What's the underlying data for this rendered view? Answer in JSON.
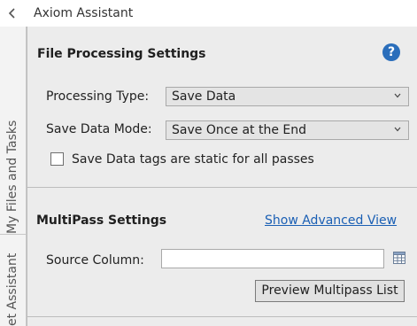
{
  "app": {
    "title": "Axiom Assistant",
    "back_icon": "chevron-left-icon"
  },
  "sidebar": {
    "tabs": [
      {
        "label": "My Files and Tasks"
      },
      {
        "label": "et Assistant"
      }
    ]
  },
  "file_processing": {
    "title": "File Processing Settings",
    "help_icon": "help-circle-icon",
    "help_glyph": "?",
    "processing_type": {
      "label": "Processing Type:",
      "value": "Save Data"
    },
    "save_data_mode": {
      "label": "Save Data Mode:",
      "value": "Save Once at the End"
    },
    "static_tags": {
      "label": "Save Data tags are static for all passes",
      "checked": false
    }
  },
  "multipass": {
    "title": "MultiPass Settings",
    "advanced_link": "Show Advanced View",
    "source_column": {
      "label": "Source Column:",
      "value": "",
      "placeholder": ""
    },
    "grid_icon": "table-grid-icon",
    "preview_button": "Preview Multipass List"
  },
  "colors": {
    "accent": "#2a6ebb",
    "link": "#1a5fb4",
    "panel_bg": "#ececec"
  }
}
